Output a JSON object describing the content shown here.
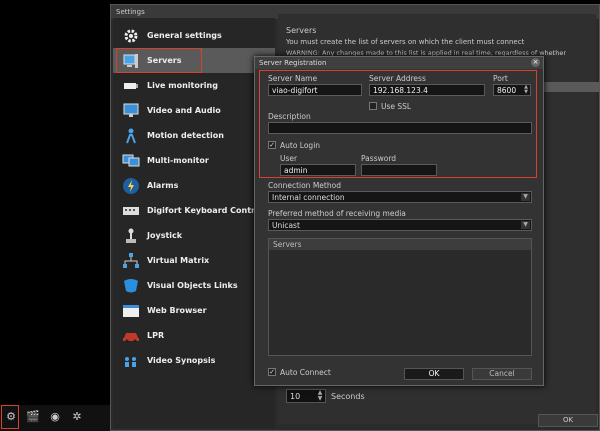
{
  "window": {
    "title": "Settings",
    "ok_label": "OK"
  },
  "sidebar": {
    "items": [
      {
        "label": "General settings",
        "icon": "gear-icon"
      },
      {
        "label": "Servers",
        "icon": "server-icon",
        "selected": true
      },
      {
        "label": "Live monitoring",
        "icon": "camera-icon"
      },
      {
        "label": "Video and Audio",
        "icon": "monitor-icon"
      },
      {
        "label": "Motion detection",
        "icon": "person-icon"
      },
      {
        "label": "Multi-monitor",
        "icon": "multi-monitor-icon"
      },
      {
        "label": "Alarms",
        "icon": "lightning-icon"
      },
      {
        "label": "Digifort Keyboard Control",
        "icon": "keyboard-icon"
      },
      {
        "label": "Joystick",
        "icon": "joystick-icon"
      },
      {
        "label": "Virtual Matrix",
        "icon": "network-icon"
      },
      {
        "label": "Visual Objects Links",
        "icon": "link-icon"
      },
      {
        "label": "Web Browser",
        "icon": "browser-icon"
      },
      {
        "label": "LPR",
        "icon": "car-icon"
      },
      {
        "label": "Video Synopsis",
        "icon": "synopsis-icon"
      }
    ]
  },
  "servers_panel": {
    "legend": "Servers",
    "description": "You must create the list of servers on which the client must connect",
    "warning": "WARNING: Any changes made to this list is applied in real time, regardless of whether",
    "seconds_value": "10",
    "seconds_label": "Seconds"
  },
  "dialog": {
    "title": "Server Registration",
    "close_symbol": "×",
    "server_name_label": "Server Name",
    "server_name_value": "viao-digifort",
    "server_address_label": "Server Address",
    "server_address_value": "192.168.123.4",
    "port_label": "Port",
    "port_value": "8600",
    "use_ssl_label": "Use SSL",
    "description_label": "Description",
    "description_value": "",
    "auto_login_label": "Auto Login",
    "auto_login_checked": true,
    "user_label": "User",
    "user_value": "admin",
    "password_label": "Password",
    "password_value": "",
    "connection_method_label": "Connection Method",
    "connection_method_value": "Internal connection",
    "media_label": "Preferred method of receiving media",
    "media_value": "Unicast",
    "servers_list_header": "Servers",
    "auto_connect_label": "Auto Connect",
    "auto_connect_checked": true,
    "ok_label": "OK",
    "cancel_label": "Cancel"
  },
  "colors": {
    "highlight": "#d9412f",
    "background": "#2b2b2b"
  }
}
